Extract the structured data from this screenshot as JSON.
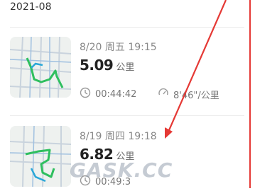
{
  "month_header": "2021-08",
  "records": [
    {
      "date": "8/20 周五 19:15",
      "distance": "5.09",
      "distance_unit": "公里",
      "duration": "00:44:42",
      "pace": "8'46\"/公里"
    },
    {
      "date": "8/19 周四 19:18",
      "distance": "6.82",
      "distance_unit": "公里",
      "duration": "00:49:3"
    }
  ],
  "icons": {
    "duration": "clock-icon",
    "pace": "speedometer-icon"
  },
  "colors": {
    "route": "#2fbf5f",
    "annotation": "#e53935"
  }
}
